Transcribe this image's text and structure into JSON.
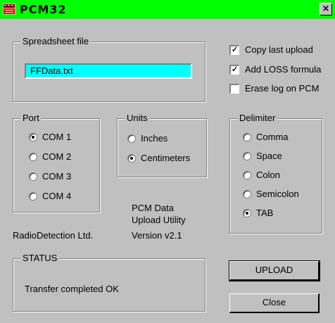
{
  "window": {
    "title": "PCM32",
    "close_label": "×"
  },
  "spreadsheet": {
    "legend": "Spreadsheet file",
    "value": "FFData.txt"
  },
  "options": [
    {
      "label": "Copy last upload",
      "checked": true
    },
    {
      "label": "Add LOSS formula",
      "checked": true
    },
    {
      "label": "Erase log on PCM",
      "checked": false
    }
  ],
  "port": {
    "legend": "Port",
    "items": [
      {
        "label": "COM 1",
        "selected": true
      },
      {
        "label": "COM 2",
        "selected": false
      },
      {
        "label": "COM 3",
        "selected": false
      },
      {
        "label": "COM 4",
        "selected": false
      }
    ]
  },
  "units": {
    "legend": "Units",
    "items": [
      {
        "label": "Inches",
        "selected": false
      },
      {
        "label": "Centimeters",
        "selected": true
      }
    ]
  },
  "delimiter": {
    "legend": "Delimiter",
    "items": [
      {
        "label": "Comma",
        "selected": false
      },
      {
        "label": "Space",
        "selected": false
      },
      {
        "label": "Colon",
        "selected": false
      },
      {
        "label": "Semicolon",
        "selected": false
      },
      {
        "label": "TAB",
        "selected": true
      }
    ]
  },
  "info": {
    "line1": "PCM Data",
    "line2": "Upload Utility",
    "version": "Version v2.1",
    "company": "RadioDetection Ltd."
  },
  "status": {
    "legend": "STATUS",
    "message": "Transfer completed OK"
  },
  "buttons": {
    "upload": "UPLOAD",
    "close": "Close"
  },
  "colors": {
    "titlebar": "#00ff00",
    "field": "#00ffff",
    "face": "#c0c0c0"
  }
}
